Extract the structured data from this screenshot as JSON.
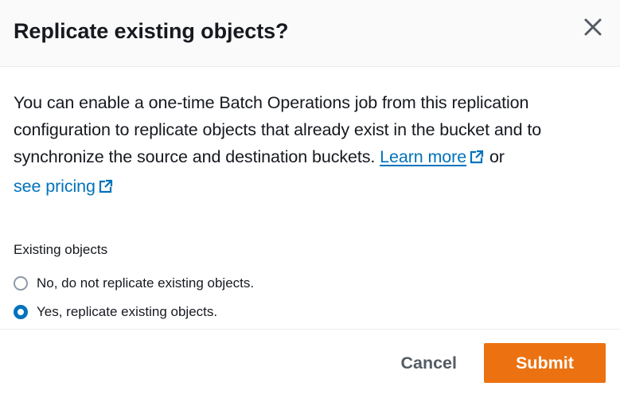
{
  "dialog": {
    "title": "Replicate existing objects?",
    "close_icon": "close-icon"
  },
  "body": {
    "description": "You can enable a one-time Batch Operations job from this replication configuration to replicate objects that already exist in the bucket and to synchronize the source and destination buckets. ",
    "learn_more": "Learn more",
    "connector": " or",
    "see_pricing": "see pricing",
    "external_icon": "external-link-icon",
    "link_color": "#0073bb"
  },
  "existing_objects": {
    "label": "Existing objects",
    "options": [
      {
        "label": "No, do not replicate existing objects.",
        "selected": false
      },
      {
        "label": "Yes, replicate existing objects.",
        "selected": true
      }
    ],
    "selected_color": "#0073bb"
  },
  "footer": {
    "cancel_label": "Cancel",
    "submit_label": "Submit",
    "submit_color": "#ec7211"
  }
}
